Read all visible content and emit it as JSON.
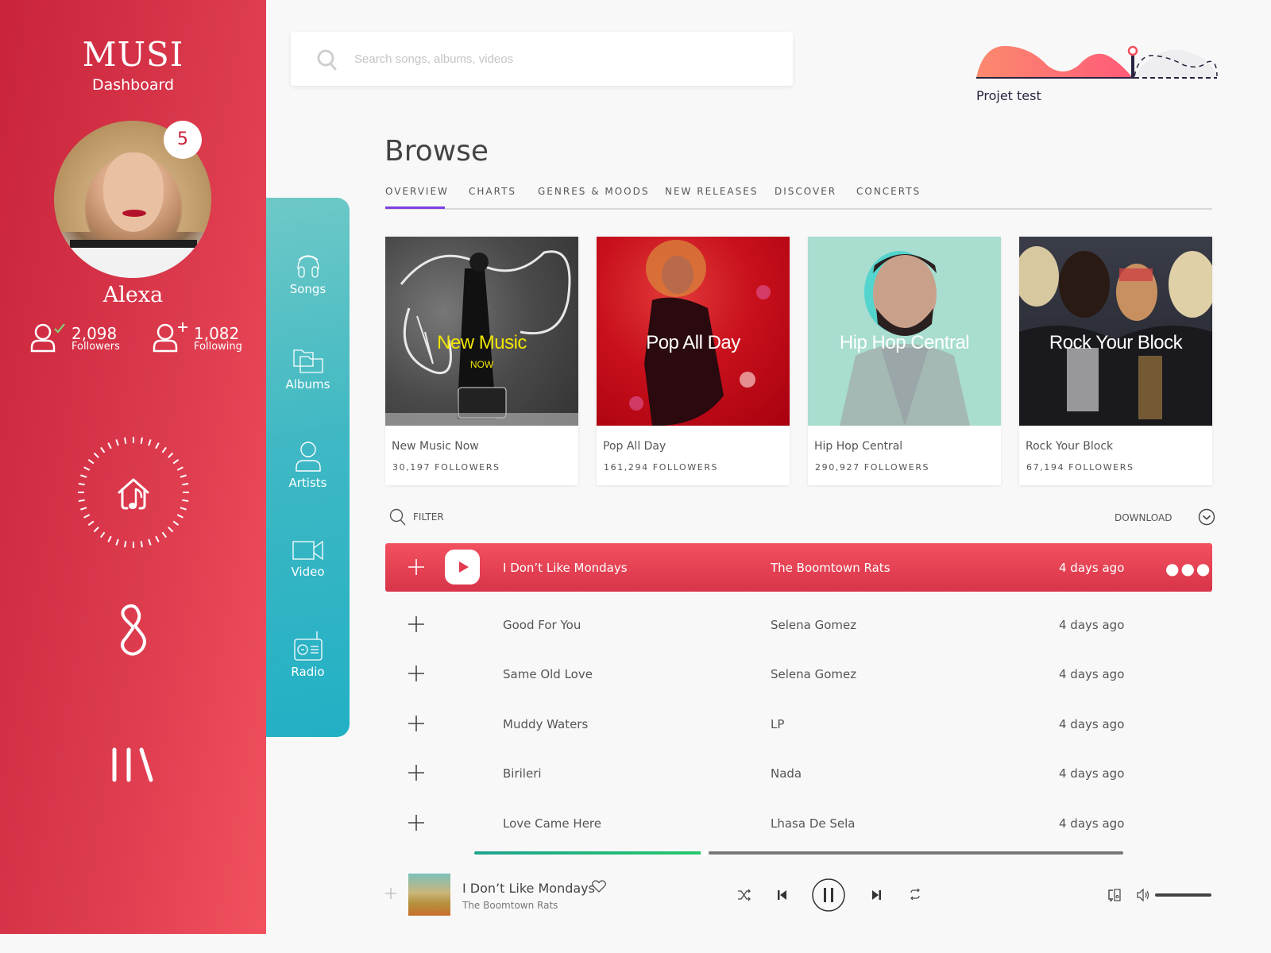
{
  "app": {
    "brand": "MUSI",
    "subtitle": "Dashboard"
  },
  "profile": {
    "name": "Alexa",
    "notification_count": "5",
    "followers": {
      "count": "2,098",
      "label": "Followers"
    },
    "following": {
      "count": "1,082",
      "label": "Following"
    }
  },
  "left_icons": [
    "home-music-icon",
    "s-logo-icon",
    "library-icon"
  ],
  "nav": {
    "items": [
      {
        "label": "Songs",
        "icon": "headphones-icon"
      },
      {
        "label": "Albums",
        "icon": "folders-icon"
      },
      {
        "label": "Artists",
        "icon": "person-icon"
      },
      {
        "label": "Video",
        "icon": "video-camera-icon"
      },
      {
        "label": "Radio",
        "icon": "radio-icon"
      }
    ]
  },
  "search": {
    "placeholder": "Search songs, albums, videos",
    "value": ""
  },
  "project": {
    "label": "Projet test",
    "progress": 0.66
  },
  "browse": {
    "title": "Browse",
    "tabs": [
      "OVERVIEW",
      "CHARTS",
      "GENRES & MOODS",
      "NEW RELEASES",
      "DISCOVER",
      "CONCERTS"
    ],
    "active_tab": "OVERVIEW"
  },
  "playlists": [
    {
      "art_title": "New Music",
      "art_subtitle": "NOW",
      "name": "New Music Now",
      "followers": "30,197 FOLLOWERS"
    },
    {
      "art_title": "Pop All Day",
      "art_subtitle": "",
      "name": "Pop All Day",
      "followers": "161,294 FOLLOWERS"
    },
    {
      "art_title": "Hip Hop Central",
      "art_subtitle": "",
      "name": "Hip Hop Central",
      "followers": "290,927 FOLLOWERS"
    },
    {
      "art_title": "Rock Your Block",
      "art_subtitle": "",
      "name": "Rock Your Block",
      "followers": "67,194 FOLLOWERS"
    }
  ],
  "list_toolbar": {
    "filter_label": "FILTER",
    "download_label": "DOWNLOAD"
  },
  "tracks": [
    {
      "song": "I Don’t Like Mondays",
      "artist": "The Boomtown Rats",
      "added": "4 days ago",
      "active": true
    },
    {
      "song": "Good For You",
      "artist": "Selena Gomez",
      "added": "4 days ago"
    },
    {
      "song": "Same Old Love",
      "artist": "Selena Gomez",
      "added": "4 days ago"
    },
    {
      "song": "Muddy Waters",
      "artist": "LP",
      "added": "4 days ago"
    },
    {
      "song": "Birileri",
      "artist": "Nada",
      "added": "4 days ago"
    },
    {
      "song": "Love Came Here",
      "artist": "Lhasa De Sela",
      "added": "4 days ago"
    }
  ],
  "player": {
    "song": "I Don’t Like Mondays",
    "artist": "The Boomtown Rats",
    "progress": 0.35,
    "volume": 1.0,
    "state": "playing"
  },
  "colors": {
    "primary_red": "#e03b4f",
    "teal": "#22b0c5",
    "tab_accent": "#7d3fe0",
    "progress_green": "#25c86b"
  }
}
